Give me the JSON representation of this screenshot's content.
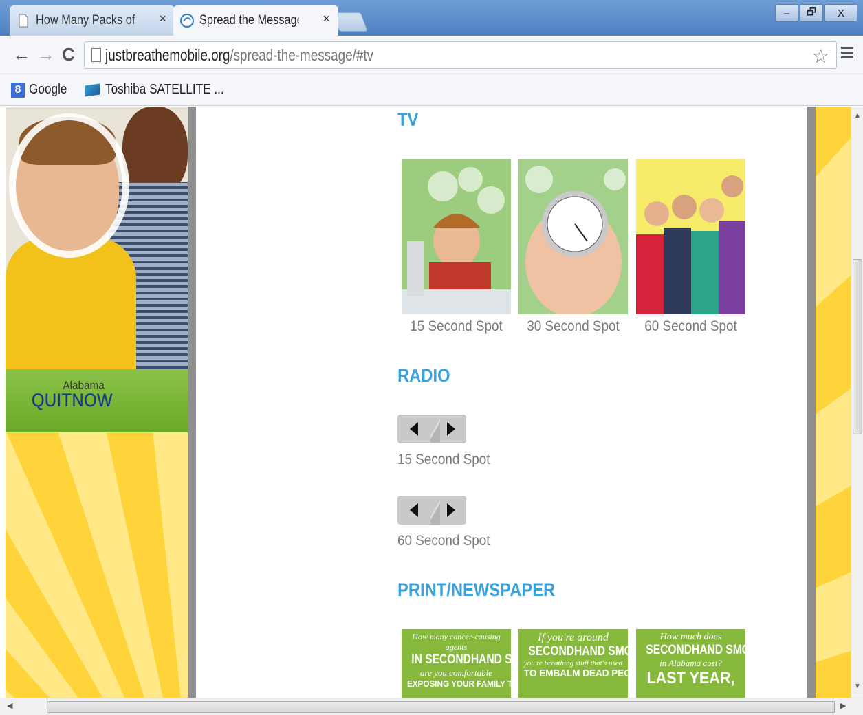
{
  "browser": {
    "tabs": [
      {
        "title": "How Many Packs of Sugar",
        "close": "×",
        "active": false
      },
      {
        "title": "Spread the Message | Just",
        "close": "×",
        "active": true
      }
    ],
    "window_buttons": {
      "minimize": "–",
      "maximize": "🗗",
      "close": "X"
    },
    "nav": {
      "back": "←",
      "forward": "→",
      "reload": "C"
    },
    "url_host": "justbreathemobile.org",
    "url_path": "/spread-the-message/#tv",
    "bookmarks": [
      {
        "label": "Google",
        "icon": "google-icon"
      },
      {
        "label": "Toshiba SATELLITE ...",
        "icon": "toshiba-icon"
      }
    ]
  },
  "sidebar": {
    "brand_small": "Alabama",
    "brand_main": "QUITNOW"
  },
  "content": {
    "tv": {
      "heading": "TV",
      "spots": [
        {
          "caption": "15 Second Spot"
        },
        {
          "caption": "30 Second Spot"
        },
        {
          "caption": "60 Second Spot"
        }
      ]
    },
    "radio": {
      "heading": "RADIO",
      "spots": [
        {
          "label": "15 Second Spot"
        },
        {
          "label": "60 Second Spot"
        }
      ]
    },
    "print": {
      "heading": "PRINT/NEWSPAPER",
      "ads": [
        {
          "l1": "How many cancer-causing agents",
          "l2": "IN SECONDHAND SMOKE",
          "l3": "are you comfortable",
          "l4": "EXPOSING YOUR FAMILY TO?"
        },
        {
          "l1": "If you're around",
          "l2": "SECONDHAND SMOKE",
          "l3": "you're breathing stuff that's used",
          "l4": "TO EMBALM DEAD PEOPLE."
        },
        {
          "l1": "How much does",
          "l2": "SECONDHAND SMOKE",
          "l3": "in Alabama cost?",
          "l4": "LAST YEAR,"
        }
      ]
    }
  },
  "colors": {
    "accent": "#3aa2dc",
    "sidebar_green": "#7ab534",
    "page_yellow": "#ffd43b"
  }
}
